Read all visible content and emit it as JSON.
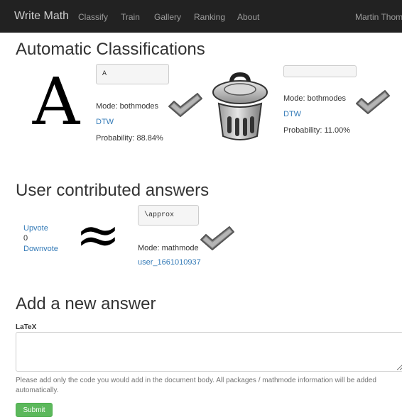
{
  "navbar": {
    "brand": "Write Math",
    "items": [
      "Classify",
      "Train",
      "Gallery",
      "Ranking",
      "About"
    ],
    "user": "Martin Thoma"
  },
  "automatic": {
    "heading": "Automatic Classifications",
    "results": [
      {
        "symbol": "A",
        "latex": "A",
        "mode": "Mode: bothmodes",
        "method": "DTW",
        "probability": "Probability: 88.84%"
      },
      {
        "symbol": "trash-can",
        "latex": "",
        "mode": "Mode: bothmodes",
        "method": "DTW",
        "probability": "Probability: 11.00%"
      }
    ]
  },
  "user_answers": {
    "heading": "User contributed answers",
    "items": [
      {
        "upvote": "Upvote",
        "votes": "0",
        "downvote": "Downvote",
        "symbol": "≈",
        "latex": "\\approx",
        "mode": "Mode: mathmode",
        "user": "user_1661010937"
      }
    ]
  },
  "new_answer": {
    "heading": "Add a new answer",
    "label": "LaTeX",
    "textarea_value": "",
    "help": "Please add only the code you would add in the document body. All packages / mathmode information will be added automatically.",
    "submit": "Submit"
  },
  "icons": {
    "accept": "checkmark-icon",
    "trash": "trash-can-icon"
  },
  "colors": {
    "navbar": "#222222",
    "link": "#337ab7",
    "submit": "#5cb85c"
  }
}
